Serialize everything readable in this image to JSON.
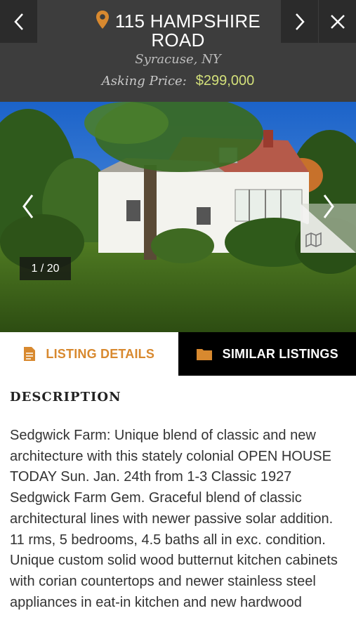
{
  "header": {
    "title": "115 HAMPSHIRE ROAD",
    "location": "Syracuse, NY",
    "price_label": "Asking Price:",
    "price": "$299,000",
    "accent_color": "#d8892f",
    "price_color": "#d3e07a",
    "icons": [
      "chevron-left-icon",
      "location-pin-icon",
      "chevron-right-icon",
      "close-icon"
    ]
  },
  "gallery": {
    "photo_counter": "1 / 20",
    "map_icon": "map-icon"
  },
  "tabs": [
    {
      "label": "LISTING DETAILS",
      "icon": "document-icon",
      "active": true
    },
    {
      "label": "SIMILAR LISTINGS",
      "icon": "folder-icon",
      "active": false
    }
  ],
  "description": {
    "heading": "DESCRIPTION",
    "text": "Sedgwick Farm: Unique blend of classic and new architecture with this stately colonial OPEN HOUSE TODAY Sun. Jan. 24th from 1-3 Classic 1927 Sedgwick Farm Gem.  Graceful blend of classic architectural lines with newer passive solar addition. 11 rms, 5 bedrooms, 4.5 baths all in exc. condition.  Unique custom solid wood butternut kitchen cabinets with corian countertops and newer stainless steel appliances in eat-in kitchen and new hardwood"
  }
}
